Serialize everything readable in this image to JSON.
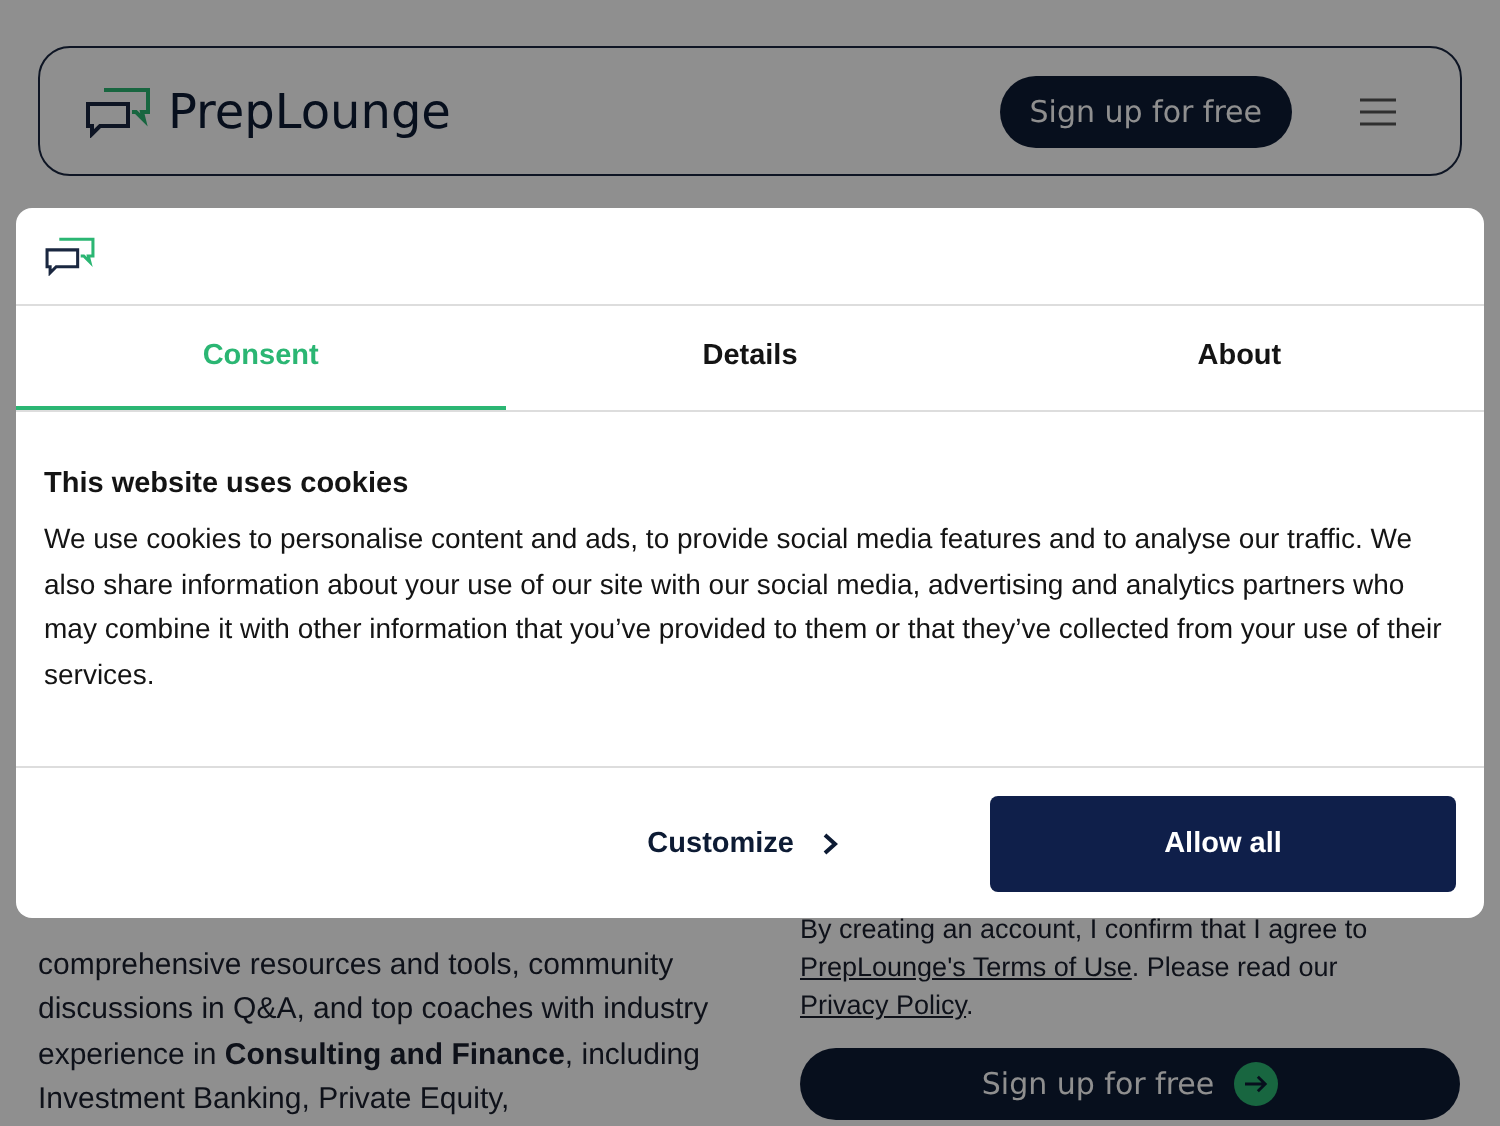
{
  "header": {
    "brand": "PrepLounge",
    "signup": "Sign up for free"
  },
  "page": {
    "intro": "comprehensive resources and tools, community discussions in Q&A, and top coaches with industry experience in **Consulting and Finance**, including Investment Banking, Private Equity,",
    "consent_before": "By creating an account, I confirm that I agree to",
    "terms_link": "PrepLounge's Terms of Use",
    "consent_middle": ". Please read our",
    "privacy_link": "Privacy Policy",
    "consent_after": ".",
    "signup": "Sign up for free"
  },
  "dialog": {
    "tabs": [
      {
        "label": "Consent",
        "selected": true
      },
      {
        "label": "Details",
        "selected": false
      },
      {
        "label": "About",
        "selected": false
      }
    ],
    "title": "This website uses cookies",
    "body": "We use cookies to personalise content and ads, to provide social media features and to analyse our traffic. We also share information about your use of our site with our social media, advertising and analytics partners who may combine it with other information that you’ve provided to them or that they’ve collected from your use of their services.",
    "customize": "Customize",
    "allow_all": "Allow all"
  }
}
